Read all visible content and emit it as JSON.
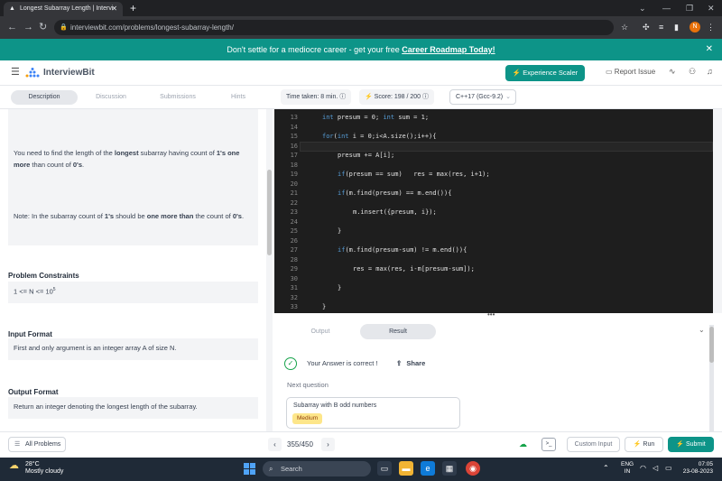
{
  "browser": {
    "tab_title": "Longest Subarray Length | Intervi",
    "new_tab": "+",
    "url": "interviewbit.com/problems/longest-subarray-length/",
    "profile_initial": "N"
  },
  "banner": {
    "text": "Don't settle for a mediocre career - get your free",
    "link": "Career Roadmap Today!"
  },
  "header": {
    "logo": "InterviewBit",
    "experience_button": "Experience Scaler",
    "report_issue": "Report Issue"
  },
  "toolbar": {
    "tabs": [
      "Description",
      "Discussion",
      "Submissions",
      "Hints"
    ],
    "timer": "Time taken: 8 min.",
    "score": "Score: 198 / 200",
    "language": "C++17 (Gcc-9.2)"
  },
  "description": {
    "para1_a": "You need to find the length of the ",
    "para1_b": "longest",
    "para1_c": " subarray having count of ",
    "para1_d": "1's one more",
    "para1_e": " than count of ",
    "para1_f": "0's",
    "para1_g": ".",
    "note_a": "Note: In the subarray count of ",
    "note_b": "1's",
    "note_c": " should be ",
    "note_d": "one more than",
    "note_e": " the count of ",
    "note_f": "0's",
    "note_g": ".",
    "constraints_title": "Problem Constraints",
    "constraints_text": "1 <= N <= 10",
    "constraints_exp": "5",
    "input_title": "Input Format",
    "input_text": "First and only argument is an integer array A of size N.",
    "output_title": "Output Format",
    "output_text": "Return an integer denoting the longest length of the subarray."
  },
  "editor": {
    "lines": [
      {
        "n": "13",
        "kw": "int",
        "code": " presum = 0; ",
        "kw2": "int",
        "code2": " sum = 1;",
        "indent": 0
      },
      {
        "n": "14",
        "kw": "",
        "code": "",
        "kw2": "",
        "code2": "",
        "indent": 0
      },
      {
        "n": "15",
        "kw": "for",
        "code": "(",
        "kw2": "int",
        "code2": " i = 0;i<A.size();i++){",
        "indent": 0
      },
      {
        "n": "16",
        "kw": "",
        "code": "",
        "kw2": "",
        "code2": "",
        "indent": 0
      },
      {
        "n": "17",
        "kw": "",
        "code": "presum += A[i];",
        "kw2": "",
        "code2": "",
        "indent": 1
      },
      {
        "n": "18",
        "kw": "",
        "code": "",
        "kw2": "",
        "code2": "",
        "indent": 0
      },
      {
        "n": "19",
        "kw": "if",
        "code": "(presum == sum)   res = max(res, i+1);",
        "kw2": "",
        "code2": "",
        "indent": 1
      },
      {
        "n": "20",
        "kw": "",
        "code": "",
        "kw2": "",
        "code2": "",
        "indent": 0
      },
      {
        "n": "21",
        "kw": "if",
        "code": "(m.find(presum) == m.end()){",
        "kw2": "",
        "code2": "",
        "indent": 1
      },
      {
        "n": "22",
        "kw": "",
        "code": "",
        "kw2": "",
        "code2": "",
        "indent": 0
      },
      {
        "n": "23",
        "kw": "",
        "code": "m.insert({presum, i});",
        "kw2": "",
        "code2": "",
        "indent": 2
      },
      {
        "n": "24",
        "kw": "",
        "code": "",
        "kw2": "",
        "code2": "",
        "indent": 0
      },
      {
        "n": "25",
        "kw": "",
        "code": "}",
        "kw2": "",
        "code2": "",
        "indent": 1
      },
      {
        "n": "26",
        "kw": "",
        "code": "",
        "kw2": "",
        "code2": "",
        "indent": 0
      },
      {
        "n": "27",
        "kw": "if",
        "code": "(m.find(presum-sum) != m.end()){",
        "kw2": "",
        "code2": "",
        "indent": 1
      },
      {
        "n": "28",
        "kw": "",
        "code": "",
        "kw2": "",
        "code2": "",
        "indent": 0
      },
      {
        "n": "29",
        "kw": "",
        "code": "res = max(res, i-m[presum-sum]);",
        "kw2": "",
        "code2": "",
        "indent": 2
      },
      {
        "n": "30",
        "kw": "",
        "code": "",
        "kw2": "",
        "code2": "",
        "indent": 0
      },
      {
        "n": "31",
        "kw": "",
        "code": "}",
        "kw2": "",
        "code2": "",
        "indent": 1
      },
      {
        "n": "32",
        "kw": "",
        "code": "",
        "kw2": "",
        "code2": "",
        "indent": 0
      },
      {
        "n": "33",
        "kw": "",
        "code": "}",
        "kw2": "",
        "code2": "",
        "indent": 0
      }
    ]
  },
  "result": {
    "tab_output": "Output",
    "tab_result": "Result",
    "message": "Your Answer is correct !",
    "share": "Share",
    "next_question": "Next question",
    "next_title": "Subarray with B odd numbers",
    "next_difficulty": "Medium"
  },
  "footer": {
    "all_problems": "All Problems",
    "page": "355/450",
    "custom_input": "Custom Input",
    "run": "Run",
    "submit": "Submit"
  },
  "taskbar": {
    "temp": "28°C",
    "weather": "Mostly cloudy",
    "search": "Search",
    "lang1": "ENG",
    "lang2": "IN",
    "time": "07:05",
    "date": "23-08-2023"
  },
  "colors": {
    "accent": "#0d9488",
    "editor_bg": "#1e1e1e",
    "keyword": "#569cd6",
    "success": "#16a34a",
    "badge": "#fde68a"
  }
}
